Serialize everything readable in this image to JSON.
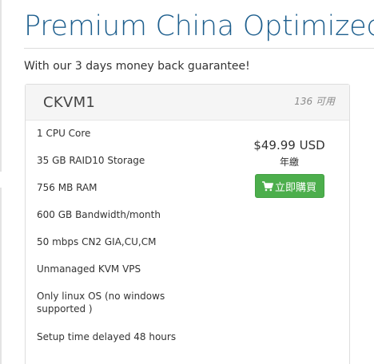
{
  "header": {
    "title": "Premium China Optimized",
    "tagline": "With our 3 days money back guarantee!"
  },
  "product": {
    "name": "CKVM1",
    "available": "136 可用",
    "features": [
      "1 CPU Core",
      "35 GB RAID10 Storage",
      "756 MB RAM",
      "600 GB Bandwidth/month",
      "50 mbps CN2 GIA,CU,CM",
      "Unmanaged KVM VPS",
      "Only linux OS (no windows supported )",
      "Setup time delayed 48 hours"
    ],
    "price": "$49.99 USD",
    "billing_cycle": "年繳",
    "buy_label": "立即購買",
    "buy_icon": "shopping-cart-icon"
  },
  "colors": {
    "title": "#1e5f8e",
    "buy_button": "#4cae4c",
    "card_header_bg": "#f5f5f5"
  }
}
